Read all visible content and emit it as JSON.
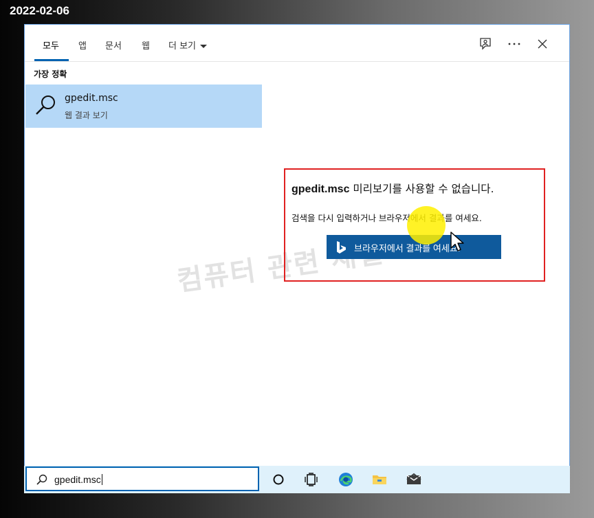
{
  "date_stamp": "2022-02-06",
  "tabs": [
    {
      "label": "모두"
    },
    {
      "label": "앱"
    },
    {
      "label": "문서"
    },
    {
      "label": "웹"
    },
    {
      "label": "더 보기"
    }
  ],
  "header_icons": [
    "feedback-icon",
    "more-options-icon",
    "close-icon"
  ],
  "section_heading": "가장 정확",
  "top_result": {
    "title": "gpedit.msc",
    "subtitle": "웹 결과 보기"
  },
  "preview": {
    "query": "gpedit.msc",
    "title_rest": "미리보기를 사용할 수 없습니다.",
    "hint": "검색을 다시 입력하거나 브라우저에서 결과를 여세요.",
    "button_label": "브라우저에서 결과를 여세요."
  },
  "watermark": "컴퓨터 관련 채널",
  "search": {
    "value": "gpedit.msc"
  },
  "taskbar_icons": [
    "cortana-icon",
    "task-view-icon",
    "edge-icon",
    "file-explorer-icon",
    "mail-icon"
  ],
  "colors": {
    "accent": "#0063b1",
    "selected_result_bg": "#b5d8f7",
    "web_button_bg": "#0f5a9c",
    "annotation_border": "#e02020",
    "taskbar_bg": "#dff1fb"
  }
}
